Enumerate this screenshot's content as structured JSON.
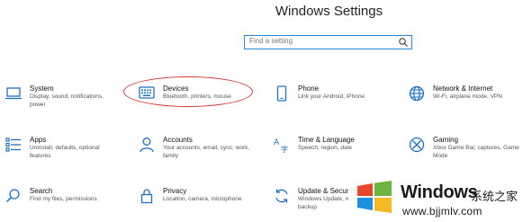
{
  "window": {
    "title": "Windows Settings"
  },
  "search": {
    "placeholder": "Find a setting"
  },
  "tiles": [
    {
      "name": "System",
      "desc": "Display, sound, notifications, power",
      "icon": "laptop-icon"
    },
    {
      "name": "Devices",
      "desc": "Bluetooth, printers, mouse",
      "icon": "keyboard-icon"
    },
    {
      "name": "Phone",
      "desc": "Link your Android, iPhone",
      "icon": "phone-icon"
    },
    {
      "name": "Network & Internet",
      "desc": "Wi-Fi, airplane mode, VPN",
      "icon": "globe-icon"
    },
    {
      "name": "Apps",
      "desc": "Uninstall, defaults, optional features",
      "icon": "apps-list-icon"
    },
    {
      "name": "Accounts",
      "desc": "Your accounts, email, sync, work, family",
      "icon": "person-icon"
    },
    {
      "name": "Time & Language",
      "desc": "Speech, region, date",
      "icon": "time-language-icon"
    },
    {
      "name": "Gaming",
      "desc": "Xbox Game Bar, captures, Game Mode",
      "icon": "xbox-icon"
    },
    {
      "name": "Search",
      "desc": "Find my files, permissions",
      "icon": "magnifier-icon"
    },
    {
      "name": "Privacy",
      "desc": "Location, camera, microphone",
      "icon": "lock-icon"
    },
    {
      "name": "Update & Security",
      "desc": "Windows Update, recovery, backup",
      "icon": "sync-icon"
    }
  ],
  "annotation": {
    "color": "#d23a3a"
  },
  "watermark": {
    "brand": "Windows",
    "cn": "系统之家",
    "url": "www.bjjmlv.com"
  },
  "colors": {
    "accent": "#2b84d8",
    "icon": "#1f6fc2"
  }
}
